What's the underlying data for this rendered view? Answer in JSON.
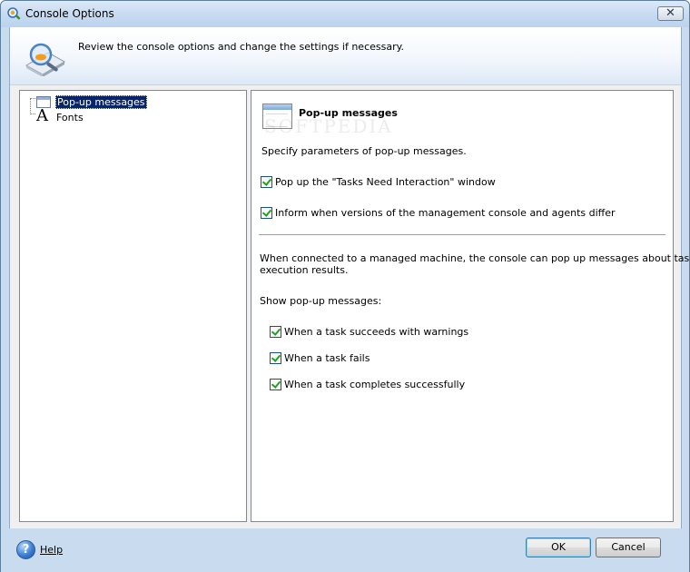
{
  "window": {
    "title": "Console Options"
  },
  "header": {
    "description": "Review the console options and change the settings if necessary."
  },
  "tree": {
    "items": [
      {
        "label": "Pop-up messages",
        "selected": true,
        "icon": "popup-window-icon"
      },
      {
        "label": "Fonts",
        "selected": false,
        "icon": "font-icon"
      }
    ]
  },
  "section": {
    "title": "Pop-up messages",
    "watermark": "SOFTPEDIA",
    "description": "Specify parameters of pop-up messages.",
    "options": [
      {
        "label": "Pop up the \"Tasks Need Interaction\" window",
        "checked": true
      },
      {
        "label": "Inform when versions of the management console and agents differ",
        "checked": true
      }
    ],
    "managed_text_line1": "When connected to a managed machine, the console can pop up messages about task",
    "managed_text_line2": "execution results.",
    "show_label": "Show pop-up messages:",
    "show_options": [
      {
        "label": "When a task succeeds with warnings",
        "checked": true
      },
      {
        "label": "When a task fails",
        "checked": true
      },
      {
        "label": "When a task completes successfully",
        "checked": true
      }
    ]
  },
  "footer": {
    "help_label": "Help",
    "ok_label": "OK",
    "cancel_label": "Cancel"
  },
  "colors": {
    "frame": "#c9dbee",
    "selection": "#0a246a",
    "checkmark": "#21a121"
  }
}
